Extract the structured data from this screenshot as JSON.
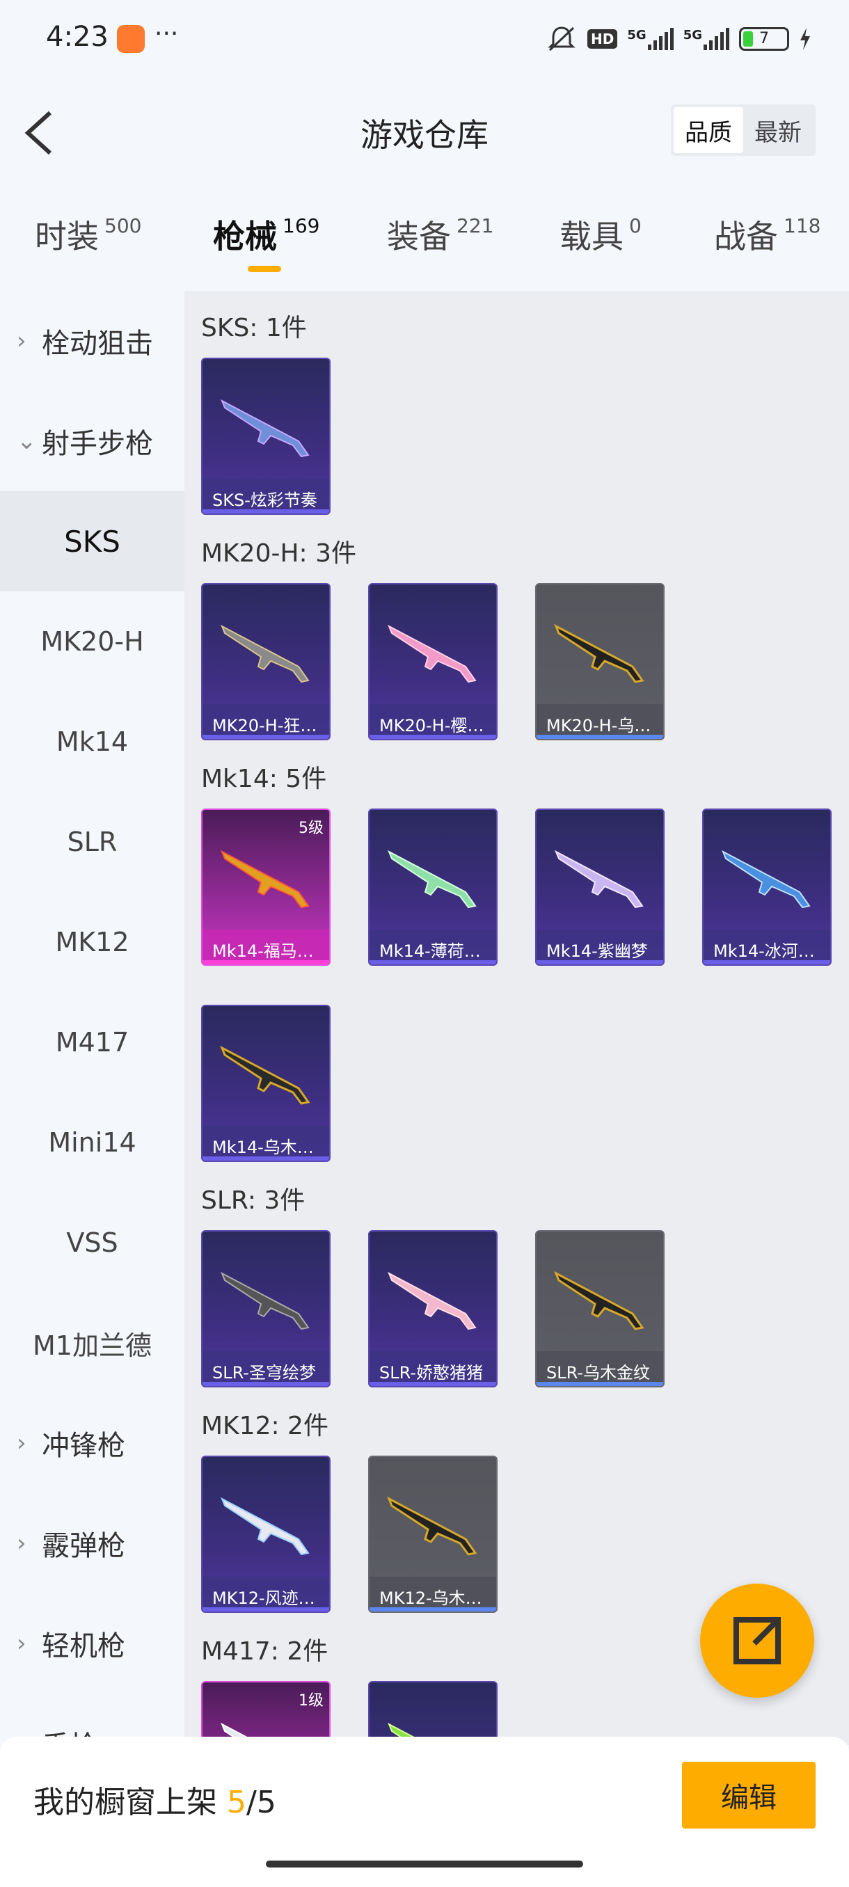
{
  "status": {
    "time": "4:23",
    "dots": "···",
    "hd": "HD",
    "net1": "5G",
    "net2": "5G",
    "battery": "7"
  },
  "header": {
    "title": "游戏仓库",
    "sort_quality": "品质",
    "sort_latest": "最新"
  },
  "tabs": [
    {
      "label": "时装",
      "count": "500"
    },
    {
      "label": "枪械",
      "count": "169"
    },
    {
      "label": "装备",
      "count": "221"
    },
    {
      "label": "载具",
      "count": "0"
    },
    {
      "label": "战备",
      "count": "118"
    }
  ],
  "sidebar": {
    "items": [
      {
        "label": "栓动狙击",
        "chev": "›"
      },
      {
        "label": "射手步枪",
        "chev": "⌄"
      },
      {
        "label": "SKS"
      },
      {
        "label": "MK20-H"
      },
      {
        "label": "Mk14"
      },
      {
        "label": "SLR"
      },
      {
        "label": "MK12"
      },
      {
        "label": "M417"
      },
      {
        "label": "Mini14"
      },
      {
        "label": "VSS"
      },
      {
        "label": "M1加兰德"
      },
      {
        "label": "冲锋枪",
        "chev": "›"
      },
      {
        "label": "霰弹枪",
        "chev": "›"
      },
      {
        "label": "轻机枪",
        "chev": "›"
      },
      {
        "label": "手枪",
        "chev": "›"
      }
    ]
  },
  "sections": [
    {
      "title": "SKS: 1件",
      "items": [
        {
          "name": "SKS-炫彩节奏"
        }
      ]
    },
    {
      "title": "MK20-H: 3件",
      "items": [
        {
          "name": "MK20-H-狂…"
        },
        {
          "name": "MK20-H-樱…"
        },
        {
          "name": "MK20-H-乌…"
        }
      ]
    },
    {
      "title": "Mk14: 5件",
      "items": [
        {
          "name": "Mk14-福马…",
          "level": "5级"
        },
        {
          "name": "Mk14-薄荷…"
        },
        {
          "name": "Mk14-紫幽梦"
        },
        {
          "name": "Mk14-冰河…"
        },
        {
          "name": "Mk14-乌木…"
        }
      ]
    },
    {
      "title": "SLR: 3件",
      "items": [
        {
          "name": "SLR-圣穹绘梦"
        },
        {
          "name": "SLR-娇憨猪猪"
        },
        {
          "name": "SLR-乌木金纹"
        }
      ]
    },
    {
      "title": "MK12: 2件",
      "items": [
        {
          "name": "MK12-风迹…"
        },
        {
          "name": "MK12-乌木…"
        }
      ]
    },
    {
      "title": "M417: 2件",
      "items": [
        {
          "name": "",
          "level": "1级"
        },
        {
          "name": ""
        }
      ]
    }
  ],
  "bottom": {
    "prefix": "我的橱窗上架 ",
    "count": "5",
    "total": "/5",
    "edit": "编辑"
  },
  "icons": {
    "back": "chevron-left-icon",
    "share": "share-external-icon"
  },
  "colors": {
    "accent": "#ffac00",
    "rare": "#5b48b0",
    "legendary": "#e050e0",
    "common": "#6a6b72"
  }
}
